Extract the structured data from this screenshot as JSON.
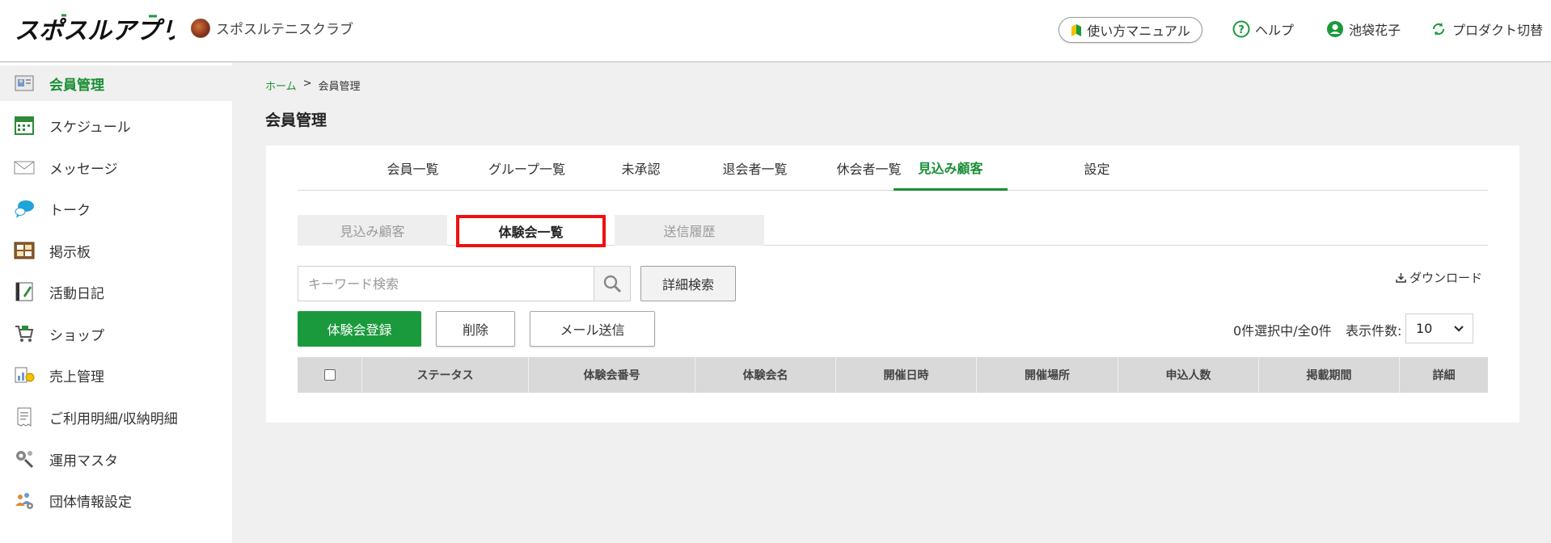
{
  "header": {
    "logo_text": "スポスルアプリ",
    "club_name": "スポスルテニスクラブ",
    "manual_label": "使い方マニュアル",
    "help_label": "ヘルプ",
    "user_name": "池袋花子",
    "switch_label": "プロダクト切替"
  },
  "sidebar": {
    "items": [
      {
        "label": "会員管理",
        "icon": "member-card-icon",
        "active": true
      },
      {
        "label": "スケジュール",
        "icon": "calendar-icon"
      },
      {
        "label": "メッセージ",
        "icon": "envelope-icon"
      },
      {
        "label": "トーク",
        "icon": "chat-bubble-icon"
      },
      {
        "label": "掲示板",
        "icon": "bulletin-board-icon"
      },
      {
        "label": "活動日記",
        "icon": "notebook-icon"
      },
      {
        "label": "ショップ",
        "icon": "shopping-cart-icon"
      },
      {
        "label": "売上管理",
        "icon": "sales-chart-icon"
      },
      {
        "label": "ご利用明細/収納明細",
        "icon": "receipt-icon"
      },
      {
        "label": "運用マスタ",
        "icon": "wrench-gear-icon"
      },
      {
        "label": "団体情報設定",
        "icon": "group-settings-icon"
      }
    ]
  },
  "breadcrumb": {
    "home": "ホーム",
    "separator": ">",
    "current": "会員管理"
  },
  "page_title": "会員管理",
  "tabs": [
    {
      "label": "会員一覧"
    },
    {
      "label": "グループ一覧"
    },
    {
      "label": "未承認"
    },
    {
      "label": "退会者一覧"
    },
    {
      "label": "休会者一覧"
    },
    {
      "label": "見込み顧客",
      "active": true
    },
    {
      "label": "設定"
    }
  ],
  "subtabs": [
    {
      "label": "見込み顧客"
    },
    {
      "label": "体験会一覧",
      "active": true
    },
    {
      "label": "送信履歴"
    }
  ],
  "search": {
    "placeholder": "キーワード検索",
    "value": ""
  },
  "detail_search_label": "詳細検索",
  "download_label": "ダウンロード",
  "actions": {
    "register": "体験会登録",
    "delete": "削除",
    "mail": "メール送信"
  },
  "selection_count": "0件選択中/全0件",
  "per_page": {
    "label": "表示件数:",
    "value": "10"
  },
  "table": {
    "columns": [
      "ステータス",
      "体験会番号",
      "体験会名",
      "開催日時",
      "開催場所",
      "申込人数",
      "掲載期間",
      "詳細"
    ]
  },
  "colors": {
    "accent": "#1a9a3c",
    "highlight_border": "#e11111"
  }
}
